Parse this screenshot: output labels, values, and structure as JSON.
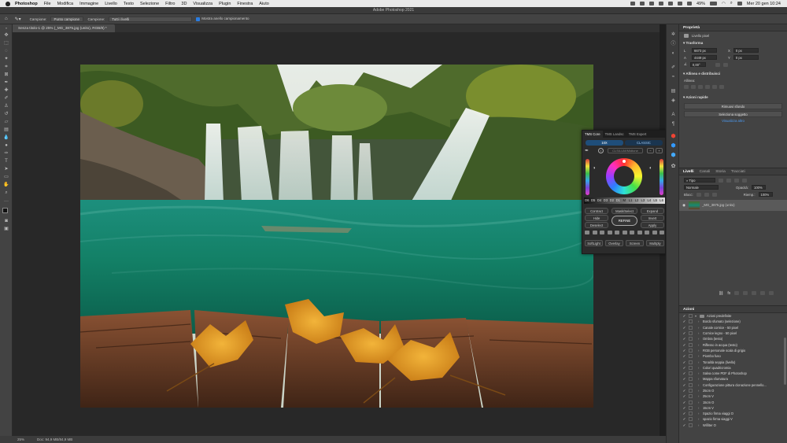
{
  "menubar": {
    "app_name": "Photoshop",
    "items": [
      "File",
      "Modifica",
      "Immagine",
      "Livello",
      "Testo",
      "Selezione",
      "Filtro",
      "3D",
      "Visualizza",
      "Plugin",
      "Finestra",
      "Aiuto"
    ],
    "battery": "49%",
    "datetime": "Mer 20 gen  10:24"
  },
  "window_title": "Adobe Photoshop 2021",
  "options_bar": {
    "sample_label": "Campione:",
    "sample_size": "Punto campione",
    "sample_layers_label": "Campione:",
    "sample_layers": "Tutti i livelli",
    "show_ring": "Mostra anello campionamento"
  },
  "document_tab": {
    "title": "Senza titolo-1 @ 25% (_MG_3875.jpg (unito), RGB/8) *"
  },
  "status_bar": {
    "zoom": "25%",
    "doc_info": "Doc: 94,9 MB/84,9 MB"
  },
  "properties": {
    "header": "Proprietà",
    "type": "Livello pixel",
    "transform_title": "Trasforma",
    "w_label": "L",
    "w_value": "6673 px",
    "h_label": "A",
    "h_value": "4449 px",
    "x_label": "X",
    "x_value": "0 px",
    "y_label": "Y",
    "y_value": "0 px",
    "angle": "0,00°",
    "align_title": "Allinea e distribuisci",
    "align_label": "Allinea:",
    "quick_actions_title": "Azioni rapide",
    "remove_bg": "Rimuovi sfondo",
    "select_subject": "Seleziona soggetto",
    "view_more": "Visualizza altro"
  },
  "layers_panel": {
    "tabs": [
      "Livelli",
      "Canali",
      "Storia",
      "Tracciati"
    ],
    "filter": "Tipo",
    "blend_mode": "Normale",
    "opacity_label": "Opacità:",
    "opacity": "100%",
    "lock_label": "Blocc:",
    "fill_label": "Riemp.:",
    "fill": "100%",
    "layer_name": "_MG_3875.jpg (unito)"
  },
  "actions_panel": {
    "header": "Azioni",
    "items": [
      "Azioni predefinite",
      "Bordo sfumato (selezione)",
      "Canale cornice - 50 pixel",
      "Cornice legno - 50 pixel",
      "Ombra (testo)",
      "Riflesso in acqua (testo)",
      "RGB personale scala di grigio",
      "Piombo fuso",
      "Tonalità seppia (livello)",
      "Colori quadricromia",
      "Salva come PDF di Photoshop",
      "Mappa sfumatura",
      "Configurazione pittura clonazione pennello...",
      "25cm O",
      "25cm V",
      "15cm O",
      "15cm V",
      "Spazio firma viaggi O",
      "spazio firma viaggi V",
      "Wifilter O"
    ]
  },
  "tms": {
    "tabs": [
      "TMS Core",
      "TMS Landsc",
      "TMS Expert"
    ],
    "mode_left": "10X",
    "mode_right": "CLASSIC",
    "mode_input": "CLS/LUM/Midtone",
    "zones": [
      "D6",
      "D5",
      "D4",
      "D3",
      "D2",
      "D1",
      "M",
      "L1",
      "L2",
      "L3",
      "L4",
      "L5",
      "L6"
    ],
    "buttons": {
      "contract": "Contract",
      "mask_select": "Mask/Select",
      "expand": "Expand",
      "hide": "Hide",
      "invert": "Invert",
      "deselect": "Deselect",
      "refine": "REFINE",
      "apply": "Apply",
      "softlight": "SoftLight",
      "overlay": "Overlay",
      "screen": "Screen",
      "multiply": "Multiply"
    }
  },
  "colors": {
    "accent": "#2a7de1",
    "panel": "#434343"
  }
}
